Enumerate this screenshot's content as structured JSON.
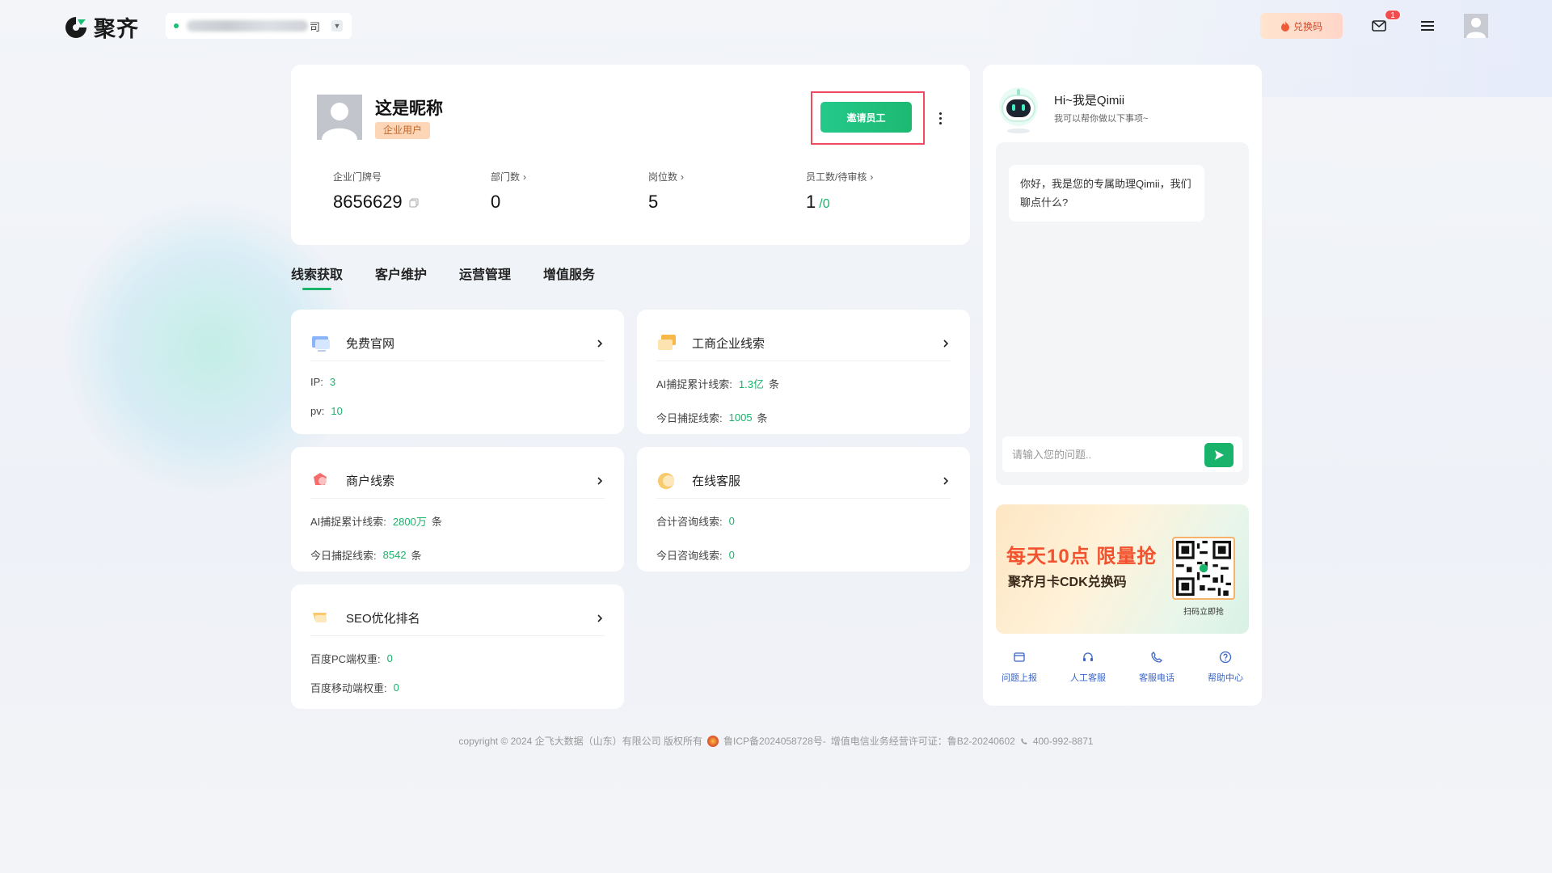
{
  "header": {
    "logo_text": "聚齐",
    "company_suffix": "司",
    "redeem_label": "兑换码",
    "mail_badge": "1"
  },
  "profile": {
    "nickname": "这是昵称",
    "user_tag": "企业用户",
    "invite_label": "邀请员工",
    "stats": [
      {
        "label": "企业门牌号",
        "value": "8656629",
        "sub": ""
      },
      {
        "label": "部门数",
        "value": "0",
        "sub": ""
      },
      {
        "label": "岗位数",
        "value": "5",
        "sub": ""
      },
      {
        "label": "员工数/待审核",
        "value": "1",
        "sub": "/0"
      }
    ]
  },
  "tabs": [
    "线索获取",
    "客户维护",
    "运营管理",
    "增值服务"
  ],
  "services": [
    {
      "title": "免费官网",
      "rows": [
        {
          "label": "IP:",
          "value": "3",
          "unit": ""
        },
        {
          "label": "pv:",
          "value": "10",
          "unit": ""
        }
      ]
    },
    {
      "title": "工商企业线索",
      "rows": [
        {
          "label": "AI捕捉累计线索:",
          "value": "1.3亿",
          "unit": "条"
        },
        {
          "label": "今日捕捉线索:",
          "value": "1005",
          "unit": "条"
        }
      ]
    },
    {
      "title": "商户线索",
      "rows": [
        {
          "label": "AI捕捉累计线索:",
          "value": "2800万",
          "unit": "条"
        },
        {
          "label": "今日捕捉线索:",
          "value": "8542",
          "unit": "条"
        }
      ]
    },
    {
      "title": "在线客服",
      "rows": [
        {
          "label": "合计咨询线索:",
          "value": "0",
          "unit": ""
        },
        {
          "label": "今日咨询线索:",
          "value": "0",
          "unit": ""
        }
      ]
    },
    {
      "title": "SEO优化排名",
      "rows": [
        {
          "label": "百度PC端权重:",
          "value": "0",
          "unit": ""
        },
        {
          "label": "百度移动端权重:",
          "value": "0",
          "unit": ""
        }
      ]
    }
  ],
  "ai": {
    "greeting": "Hi~我是Qimii",
    "subtitle": "我可以帮你做以下事项~",
    "message": "你好，我是您的专属助理Qimii，我们聊点什么?",
    "input_placeholder": "请输入您的问题..",
    "banner_title": "每天10点 限量抢",
    "banner_sub": "聚齐月卡CDK兑换码",
    "banner_qr_caption": "扫码立即抢",
    "quick": [
      "问题上报",
      "人工客服",
      "客服电话",
      "帮助中心"
    ]
  },
  "footer": {
    "copyright": "copyright © 2024 企飞大数据（山东）有限公司 版权所有",
    "icp": "鲁ICP备2024058728号-",
    "license": "增值电信业务经营许可证：鲁B2-20240602",
    "phone": "400-992-8871"
  },
  "colors": {
    "accent": "#19b36b",
    "highlight": "#ef4b5f",
    "tag_bg": "#fdd6b8"
  }
}
